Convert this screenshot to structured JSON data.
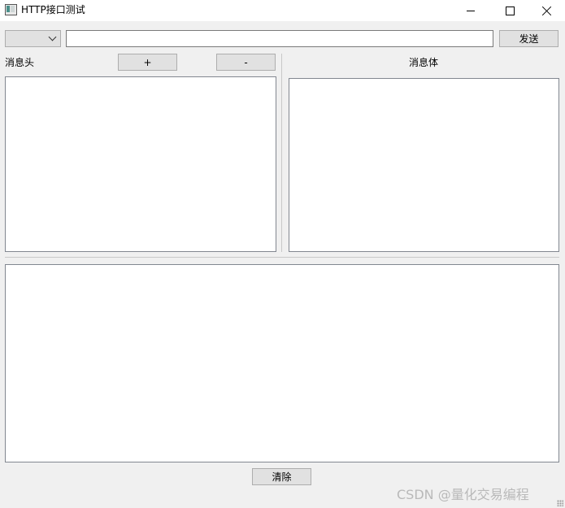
{
  "window": {
    "title": "HTTP接口测试",
    "icon": "app-window-icon",
    "controls": [
      "minimize-icon",
      "maximize-icon",
      "close-icon"
    ]
  },
  "toolbar": {
    "method_selected": "",
    "url_value": "",
    "send_label": "发送"
  },
  "headers_panel": {
    "label": "消息头",
    "add_label": "+",
    "remove_label": "-",
    "content": ""
  },
  "body_panel": {
    "label": "消息体",
    "content": ""
  },
  "output": {
    "content": ""
  },
  "clear_label": "清除",
  "watermark": "CSDN @量化交易编程",
  "colors": {
    "window_bg": "#f0f0f0",
    "button_bg": "#e1e1e1",
    "button_border": "#adadad",
    "field_border": "#828790"
  }
}
